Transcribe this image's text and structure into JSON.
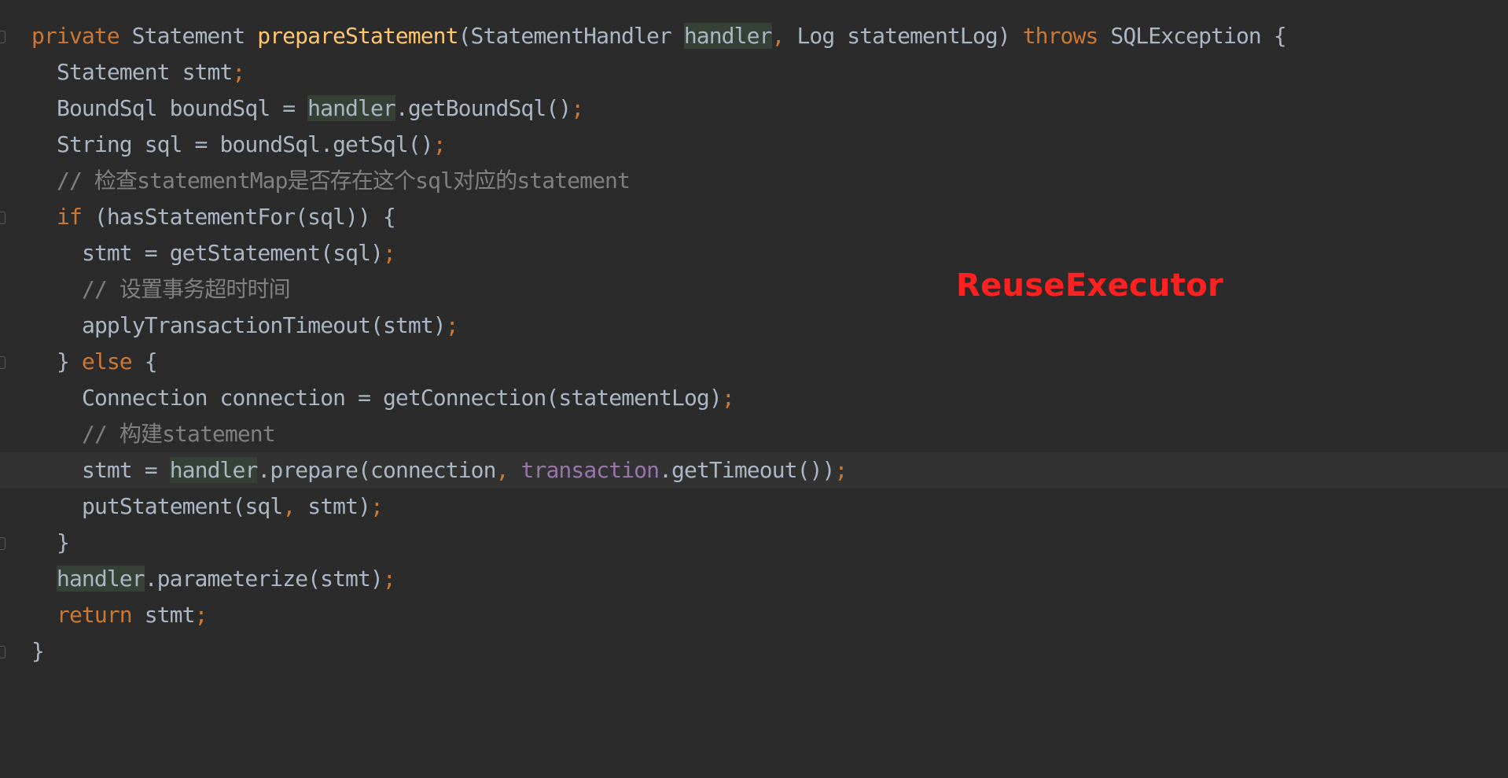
{
  "editor": {
    "theme_colors": {
      "background": "#2b2b2b",
      "keyword": "#cc7832",
      "method": "#ffc66d",
      "comment": "#808080",
      "field": "#9876aa",
      "text": "#a9b7c6",
      "usage_highlight": "#344134",
      "annotation": "#ff2020"
    },
    "lines": [
      {
        "parts": [
          "private",
          " Statement ",
          "prepareStatement",
          "(StatementHandler ",
          "handler",
          ",",
          " Log statementLog) ",
          "throws",
          " SQLException {"
        ]
      },
      {
        "parts": [
          "Statement stmt",
          ";"
        ]
      },
      {
        "parts": [
          "BoundSql boundSql = ",
          "handler",
          ".getBoundSql()",
          ";"
        ]
      },
      {
        "parts": [
          "String sql = boundSql.getSql()",
          ";"
        ]
      },
      {
        "parts": [
          "// 检查statementMap是否存在这个sql对应的statement"
        ]
      },
      {
        "parts": [
          "if",
          " (hasStatementFor(sql)) {"
        ]
      },
      {
        "parts": [
          "stmt = getStatement(sql)",
          ";"
        ]
      },
      {
        "parts": [
          "// 设置事务超时时间"
        ]
      },
      {
        "parts": [
          "applyTransactionTimeout(stmt)",
          ";"
        ]
      },
      {
        "parts": [
          "} ",
          "else",
          " {"
        ]
      },
      {
        "parts": [
          "Connection connection = getConnection(statementLog)",
          ";"
        ]
      },
      {
        "parts": [
          "// 构建statement"
        ]
      },
      {
        "parts": [
          "stmt = ",
          "handler",
          ".prepare(connection",
          ", ",
          "transaction",
          ".getTimeout())",
          ";"
        ]
      },
      {
        "parts": [
          "putStatement(sql",
          ", ",
          "stmt)",
          ";"
        ]
      },
      {
        "parts": [
          "}"
        ]
      },
      {
        "parts": [
          "handler",
          ".parameterize(stmt)",
          ";"
        ]
      },
      {
        "parts": [
          "return",
          " stmt",
          ";"
        ]
      },
      {
        "parts": [
          "}"
        ]
      }
    ]
  },
  "annotation": {
    "label": "ReuseExecutor"
  }
}
